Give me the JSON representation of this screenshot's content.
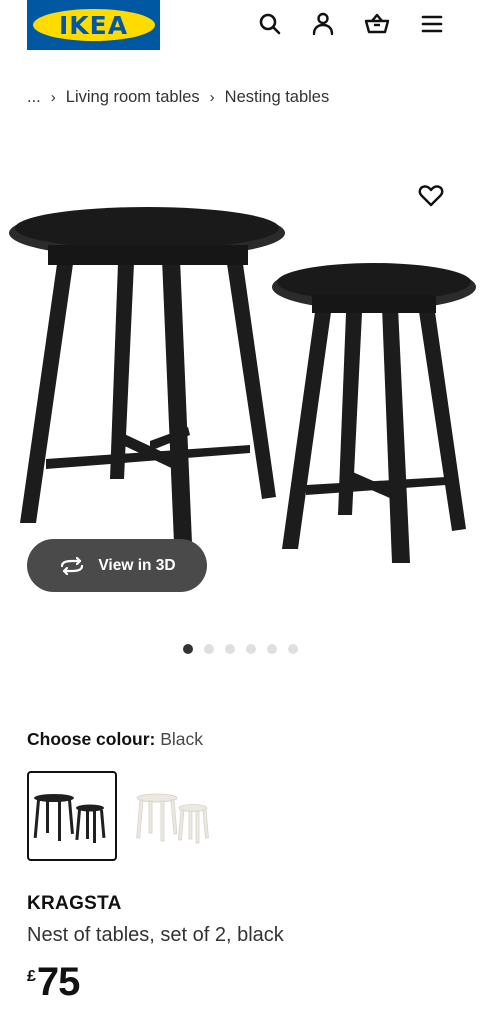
{
  "header": {
    "logo_text": "IKEA",
    "icons": [
      "search-icon",
      "profile-icon",
      "basket-icon",
      "menu-icon"
    ]
  },
  "breadcrumb": {
    "ellipsis": "...",
    "items": [
      "Living room tables",
      "Nesting tables"
    ]
  },
  "gallery": {
    "view3d_label": "View in 3D",
    "dot_count": 6,
    "active_dot": 0
  },
  "colour": {
    "label": "Choose colour:",
    "selected": "Black",
    "swatches": [
      "black",
      "white"
    ]
  },
  "product": {
    "name": "KRAGSTA",
    "description": "Nest of tables, set of 2, black",
    "currency": "£",
    "price": "75"
  },
  "colors": {
    "brand_blue": "#0058a3",
    "brand_yellow": "#ffdb00",
    "button_dark": "#4a4a4a"
  }
}
